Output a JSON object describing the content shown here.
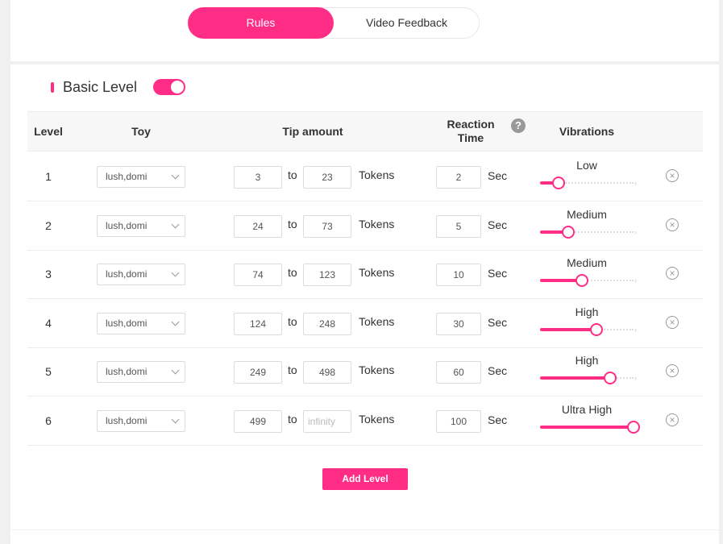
{
  "tabs": [
    {
      "label": "Rules",
      "active": true
    },
    {
      "label": "Video Feedback",
      "active": false
    }
  ],
  "section": {
    "title": "Basic Level",
    "enabled": true
  },
  "columns": {
    "level": "Level",
    "toy": "Toy",
    "tip_amount": "Tip amount",
    "reaction_time": "Reaction\nTime",
    "vibrations": "Vibrations"
  },
  "labels": {
    "to": "to",
    "tokens": "Tokens",
    "sec": "Sec",
    "help": "?"
  },
  "rows": [
    {
      "level": "1",
      "toy": "lush,domi",
      "from": "3",
      "to": "23",
      "to_placeholder": "",
      "reaction": "2",
      "vibration": "Low",
      "intensity": 0.2
    },
    {
      "level": "2",
      "toy": "lush,domi",
      "from": "24",
      "to": "73",
      "to_placeholder": "",
      "reaction": "5",
      "vibration": "Medium",
      "intensity": 0.3
    },
    {
      "level": "3",
      "toy": "lush,domi",
      "from": "74",
      "to": "123",
      "to_placeholder": "",
      "reaction": "10",
      "vibration": "Medium",
      "intensity": 0.45
    },
    {
      "level": "4",
      "toy": "lush,domi",
      "from": "124",
      "to": "248",
      "to_placeholder": "",
      "reaction": "30",
      "vibration": "High",
      "intensity": 0.6
    },
    {
      "level": "5",
      "toy": "lush,domi",
      "from": "249",
      "to": "498",
      "to_placeholder": "",
      "reaction": "60",
      "vibration": "High",
      "intensity": 0.75
    },
    {
      "level": "6",
      "toy": "lush,domi",
      "from": "499",
      "to": "",
      "to_placeholder": "infinity",
      "reaction": "100",
      "vibration": "Ultra High",
      "intensity": 1.0
    }
  ],
  "add_level_label": "Add Level",
  "colors": {
    "accent": "#ff2d86"
  }
}
